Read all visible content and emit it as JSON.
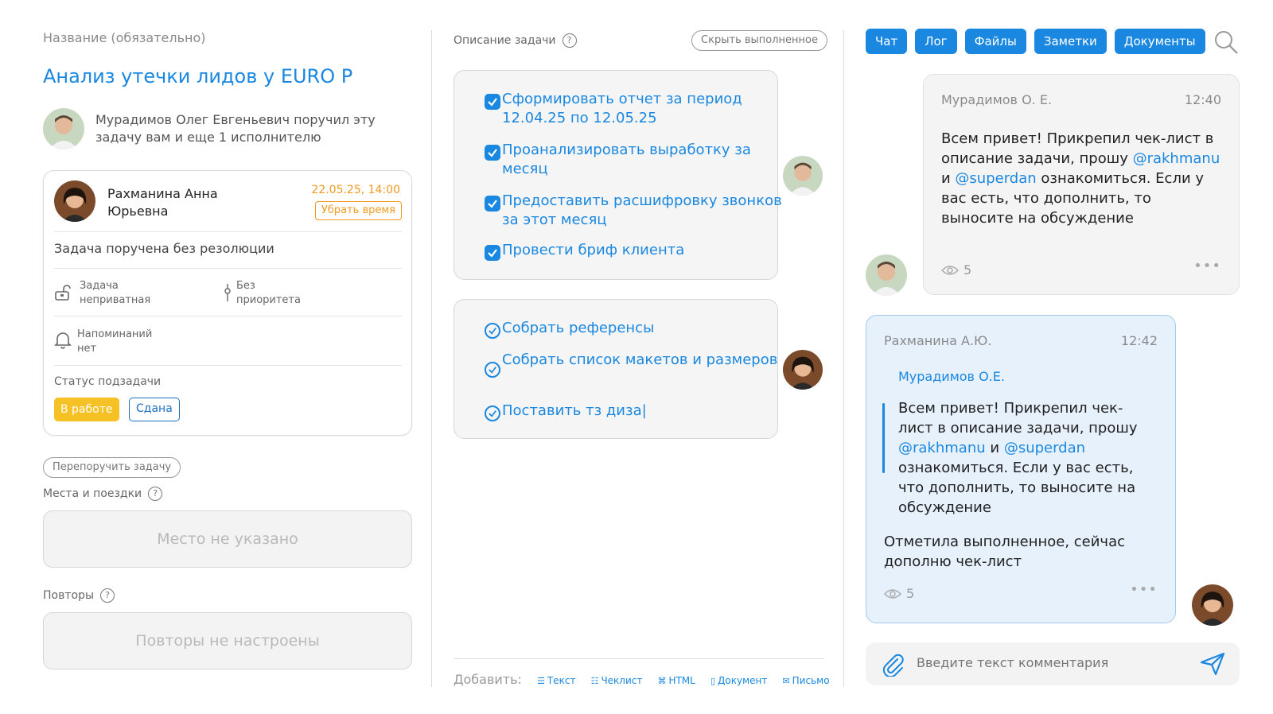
{
  "left": {
    "name_label": "Название (обязательно)",
    "title": "Анализ утечки лидов у EURO P",
    "assigner_text": "Мурадимов Олег Евгеньевич поручил эту задачу вам и еще 1 исполнителю",
    "executor": {
      "name": "Рахманина Анна Юрьевна",
      "date": "22.05.25, 14:00",
      "remove_time": "Убрать время"
    },
    "resolution": "Задача поручена без резолюции",
    "privacy_line1": "Задача",
    "privacy_line2": "неприватная",
    "priority_line1": "Без",
    "priority_line2": "приоритета",
    "reminders_line1": "Напоминаний",
    "reminders_line2": "нет",
    "status_label": "Статус подзадачи",
    "status_in_work": "В работе",
    "status_done": "Сдана",
    "reassign": "Перепоручить задачу",
    "places_label": "Места и поездки",
    "places_empty": "Место не указано",
    "repeats_label": "Повторы",
    "repeats_empty": "Повторы не настроены"
  },
  "middle": {
    "desc_label": "Описание задачи",
    "hide_done": "Скрыть выполненное",
    "checklist_done": [
      "Сформировать отчет за период 12.04.25 по 12.05.25",
      "Проанализировать выработку за месяц",
      "Предоставить расшифровку звонков за этот месяц",
      "Провести бриф клиента"
    ],
    "checklist_open": [
      "Собрать референсы",
      "Собрать список макетов и размеров",
      "Поставить тз диза|"
    ],
    "add_label": "Добавить:",
    "add_options": [
      "Текст",
      "Чеклист",
      "HTML",
      "Документ",
      "Письмо"
    ]
  },
  "right": {
    "tabs": [
      "Чат",
      "Лог",
      "Файлы",
      "Заметки",
      "Документы"
    ],
    "msg1": {
      "author": "Мурадимов О. Е.",
      "time": "12:40",
      "text_a": "Всем привет! Прикрепил чек-лист в описание задачи, прошу ",
      "mention1": "@rakhmanu",
      "and": " и ",
      "mention2": "@superdan",
      "text_b": " ознакомиться. Если у вас есть, что дополнить, то выносите на обсуждение",
      "views": "5"
    },
    "msg2": {
      "author": "Рахманина А.Ю.",
      "time": "12:42",
      "quote_author": "Мурадимов О.Е.",
      "quote_a": "Всем привет! Прикрепил чек-лист в описание задачи, прошу ",
      "mention1": "@rakhmanu",
      "and": " и ",
      "mention2": "@superdan",
      "quote_b": " ознакомиться. Если у вас есть, что дополнить, то выносите на обсуждение",
      "reply": "Отметила выполненное, сейчас дополню чек-лист",
      "views": "5"
    },
    "composer_placeholder": "Введите текст комментария"
  },
  "colors": {
    "accent": "#1a88e0",
    "warning": "#f39a1e",
    "status_yellow": "#f6c125"
  }
}
